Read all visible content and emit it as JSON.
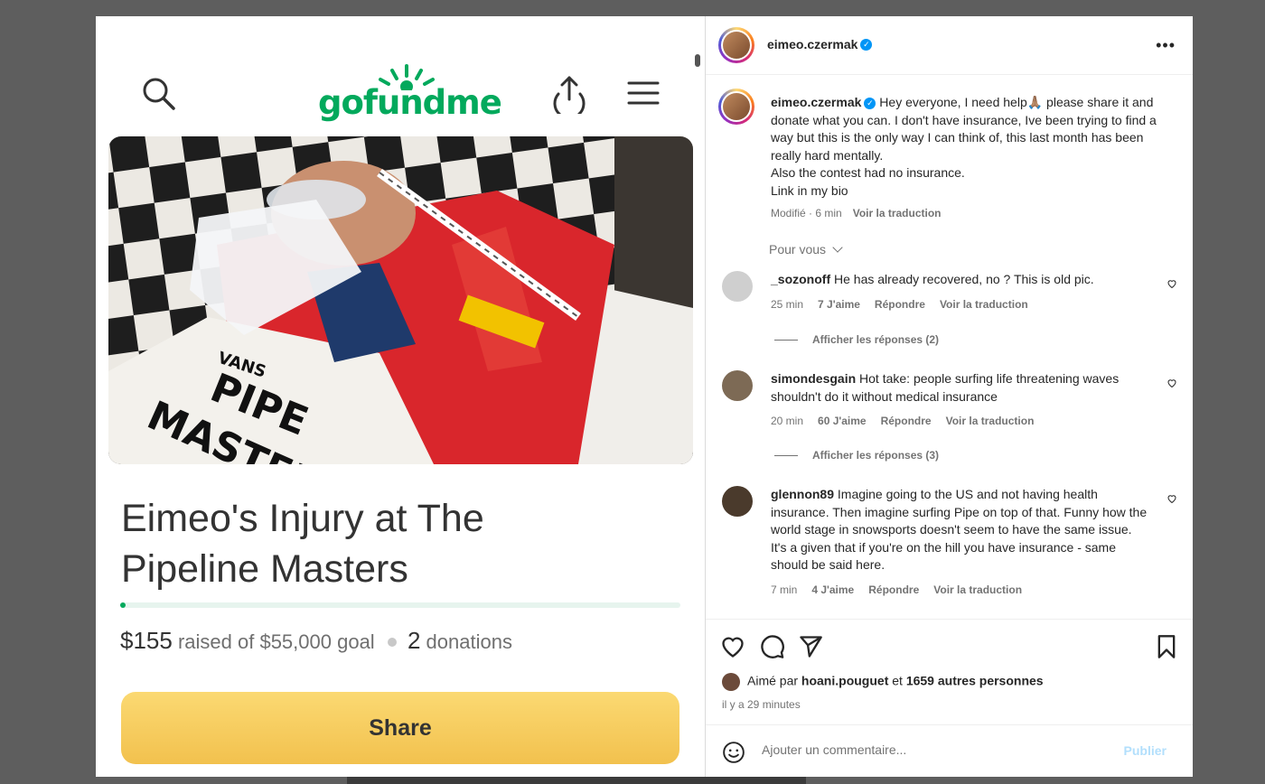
{
  "gofundme": {
    "logo_text": "gofundme",
    "campaign_title": "Eimeo's Injury at The Pipeline Masters",
    "raised": "$155",
    "raised_label": "raised of $55,000 goal",
    "donations_count": "2",
    "donations_label": "donations",
    "progress_fraction": 0.0028,
    "share_button": "Share",
    "hero_shirt_text_1": "VANS",
    "hero_shirt_text_2": "PIPE",
    "hero_shirt_text_3": "MASTERS"
  },
  "instagram": {
    "header_username": "eimeo.czermak",
    "post": {
      "username": "eimeo.czermak",
      "caption_line_1": "Hey everyone, I need help🙏🏽 please share it and donate what you can. I don't have insurance, Ive been trying to find a way but this is the only way I can think of, this last month has been really hard mentally.",
      "caption_line_2": "Also the contest had no insurance.",
      "caption_line_3": "Link in my bio",
      "meta_edited": "Modifié · 6 min",
      "meta_translate": "Voir la traduction"
    },
    "pour_vous": "Pour vous",
    "comments": [
      {
        "username": "_sozonoff",
        "text": "He has already recovered, no ? This is old pic.",
        "time": "25 min",
        "likes": "7 J'aime",
        "reply": "Répondre",
        "translate": "Voir la traduction",
        "show_replies": "Afficher les réponses (2)"
      },
      {
        "username": "simondesgain",
        "text": "Hot take: people surfing life threatening waves shouldn't do it without medical insurance",
        "time": "20 min",
        "likes": "60 J'aime",
        "reply": "Répondre",
        "translate": "Voir la traduction",
        "show_replies": "Afficher les réponses (3)"
      },
      {
        "username": "glennon89",
        "text": "Imagine going to the US and not having health insurance. Then imagine surfing Pipe on top of that. Funny how the world stage in snowsports doesn't seem to have the same issue. It's a given that if you're on the hill you have insurance - same should be said here.",
        "time": "7 min",
        "likes": "4 J'aime",
        "reply": "Répondre",
        "translate": "Voir la traduction"
      }
    ],
    "likes_prefix": "Aimé par",
    "likes_user": "hoani.pouguet",
    "likes_and": "et",
    "likes_others": "1659 autres personnes",
    "time_ago": "il y a 29 minutes",
    "comment_placeholder": "Ajouter un commentaire...",
    "publish_label": "Publier",
    "colors": {
      "brand_green": "#02a95c",
      "share_yellow": "#f2c14e",
      "ig_blue": "#0095f6"
    }
  }
}
